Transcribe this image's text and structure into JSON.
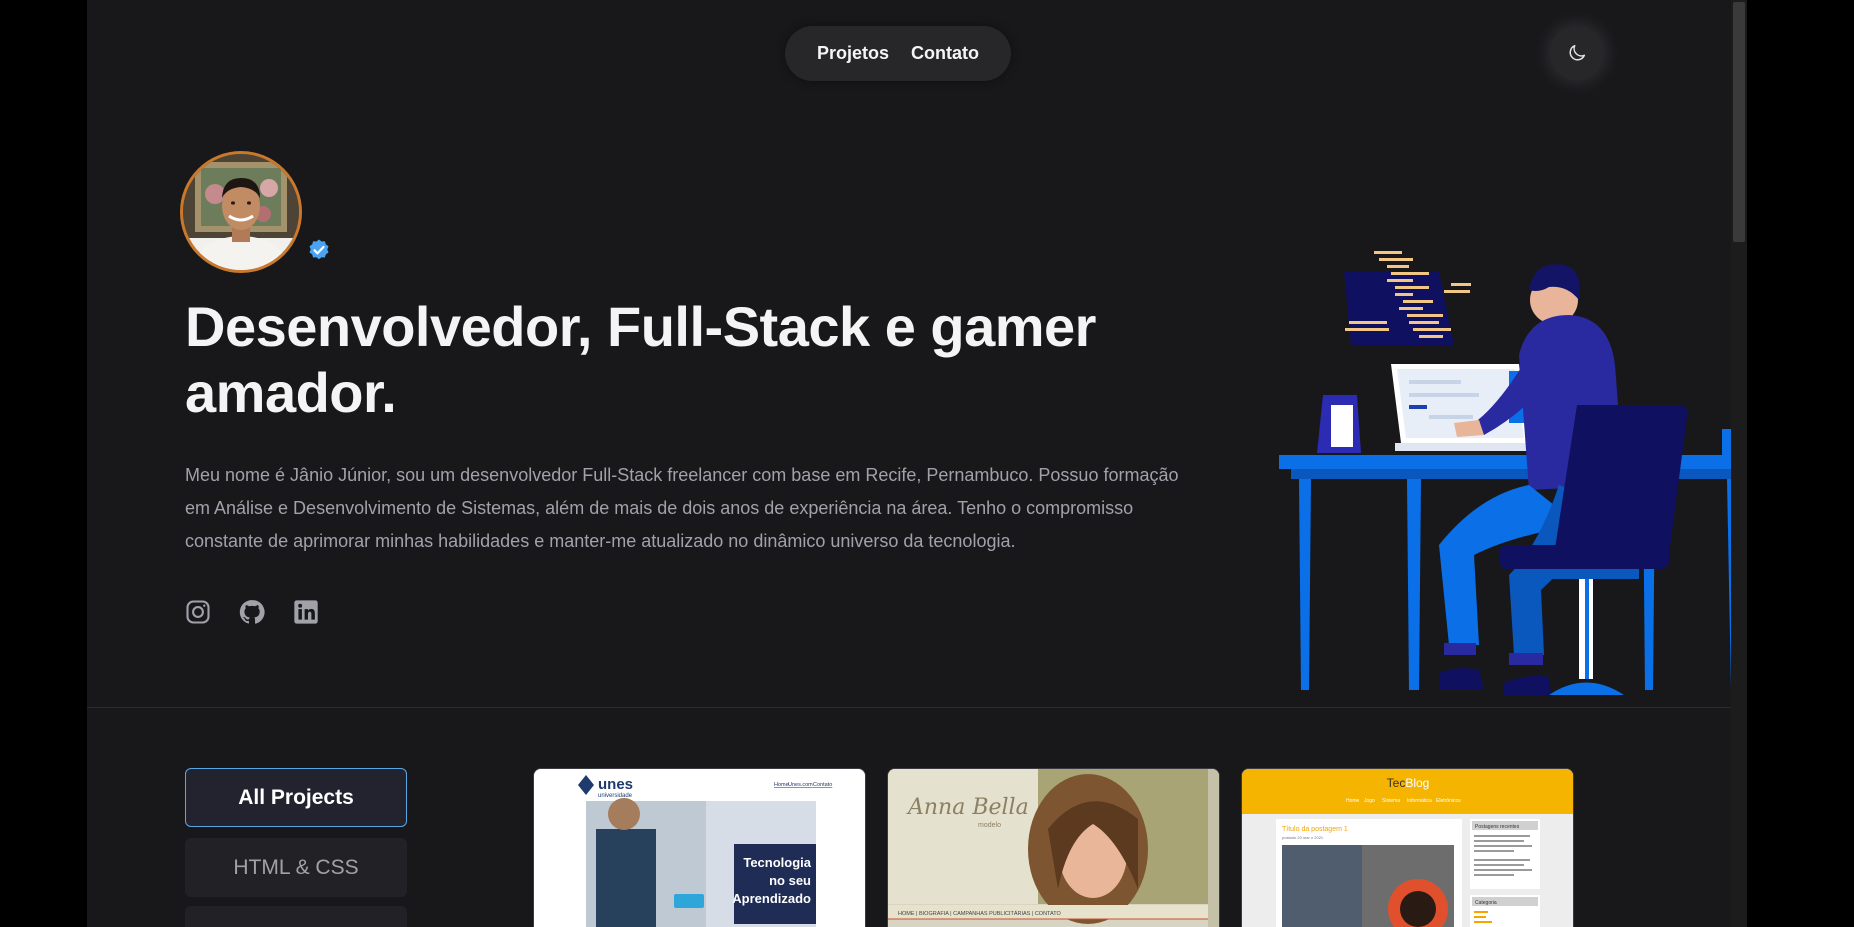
{
  "nav": {
    "links": [
      "Projetos",
      "Contato"
    ]
  },
  "theme_toggle": {
    "icon": "moon-icon"
  },
  "hero": {
    "title": "Desenvolvedor, Full-Stack e gamer amador.",
    "description": "Meu nome é Jânio Júnior, sou um desenvolvedor Full-Stack freelancer com base em Recife, Pernambuco. Possuo formação em Análise e Desenvolvimento de Sistemas, além de mais de dois anos de experiência na área. Tenho o compromisso constante de aprimorar minhas habilidades e manter-me atualizado no dinâmico universo da tecnologia.",
    "socials": [
      "instagram-icon",
      "github-icon",
      "linkedin-icon"
    ]
  },
  "filters": {
    "active": "All Projects",
    "items": [
      "All Projects",
      "HTML & CSS"
    ]
  },
  "projects": [
    {
      "brand": "unes",
      "brand_sub": "universidade",
      "nav": [
        "Home",
        "Unes.com",
        "Contato"
      ],
      "banner": [
        "Tecnologia",
        "no seu",
        "Aprendizado"
      ]
    },
    {
      "brand": "Anna Bella",
      "brand_sub": "modelo",
      "nav": "HOME | BIOGRAFIA | CAMPANHAS PUBLICITÁRIAS | CONTATO"
    },
    {
      "brand_a": "Tec",
      "brand_b": "Blog",
      "nav": [
        "Home",
        "Jogo",
        "Sistema",
        "Informática",
        "Eletrônicos"
      ],
      "post_title": "Título da postagem 1",
      "post_date": "postado 20 mar o 2021",
      "sidebar_title": "Postagens recentes",
      "sidebar_title2": "Categoria"
    }
  ],
  "colors": {
    "background": "#18181b",
    "accent": "#c9782c",
    "verified": "#4aa3f0"
  }
}
